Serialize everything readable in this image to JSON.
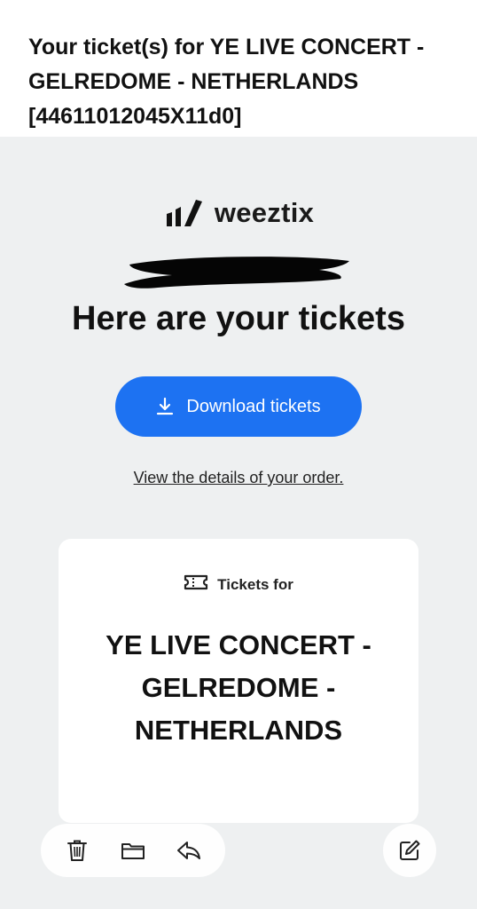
{
  "email": {
    "subject": "Your ticket(s) for YE LIVE CONCERT - GELREDOME - NETHERLANDS [44611012045X11d0]"
  },
  "brand": {
    "name": "weeztix",
    "logo_icon": "weeztix-bars-icon"
  },
  "headline": "Here are your tickets",
  "download_button": {
    "label": "Download tickets",
    "icon": "download-icon",
    "color": "#1d72f2"
  },
  "order_link": "View the details of your order.",
  "ticket_card": {
    "heading": "Tickets for",
    "heading_icon": "ticket-icon",
    "event_name": "YE LIVE CONCERT - GELREDOME - NETHERLANDS"
  },
  "toolbar": {
    "left_icons": [
      "trash-icon",
      "folder-icon",
      "reply-icon"
    ],
    "right_icon": "compose-icon"
  }
}
